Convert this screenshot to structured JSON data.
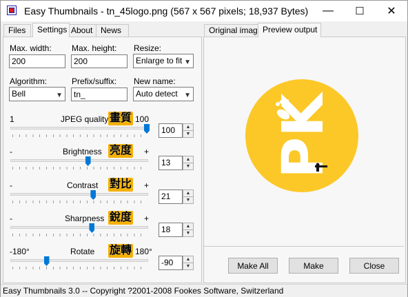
{
  "window": {
    "title": "Easy Thumbnails - tn_45logo.png  (567 x 567 pixels;  18,937 Bytes)",
    "minimize": "—",
    "maximize": "☐",
    "close": "✕"
  },
  "left_tabs": [
    "Files",
    "Settings",
    "About",
    "News"
  ],
  "right_tabs": [
    "Original image",
    "Preview output"
  ],
  "settings": {
    "max_width_label": "Max. width:",
    "max_width_value": "200",
    "max_height_label": "Max. height:",
    "max_height_value": "200",
    "resize_label": "Resize:",
    "resize_value": "Enlarge to fit",
    "algorithm_label": "Algorithm:",
    "algorithm_value": "Bell",
    "prefix_label": "Prefix/suffix:",
    "prefix_value": "tn_",
    "new_name_label": "New name:",
    "new_name_value": "Auto detect"
  },
  "sliders": {
    "jpeg": {
      "min": "1",
      "label": "JPEG quality",
      "max": "100",
      "value": "100",
      "level": 1.0,
      "annotation": "畫質"
    },
    "brightness": {
      "min": "-",
      "label": "Brightness",
      "max": "+",
      "value": "13",
      "level": 0.56,
      "annotation": "亮度"
    },
    "contrast": {
      "min": "-",
      "label": "Contrast",
      "max": "+",
      "value": "21",
      "level": 0.6,
      "annotation": "對比"
    },
    "sharpness": {
      "min": "-",
      "label": "Sharpness",
      "max": "+",
      "value": "18",
      "level": 0.59,
      "annotation": "銳度"
    },
    "rotate": {
      "min": "-180°",
      "label": "Rotate",
      "max": "180°",
      "value": "-90",
      "level": 0.25,
      "annotation": "旋轉"
    }
  },
  "buttons": {
    "make_all": "Make All",
    "make": "Make",
    "close": "Close"
  },
  "preview": {
    "logo_text": "PK",
    "circle_color": "#fcc828"
  },
  "status": "Easy Thumbnails 3.0 -- Copyright ?2001-2008 Fookes Software, Switzerland",
  "colors": {
    "accent": "#0078d7",
    "annotation_bg": "#f5b000"
  }
}
